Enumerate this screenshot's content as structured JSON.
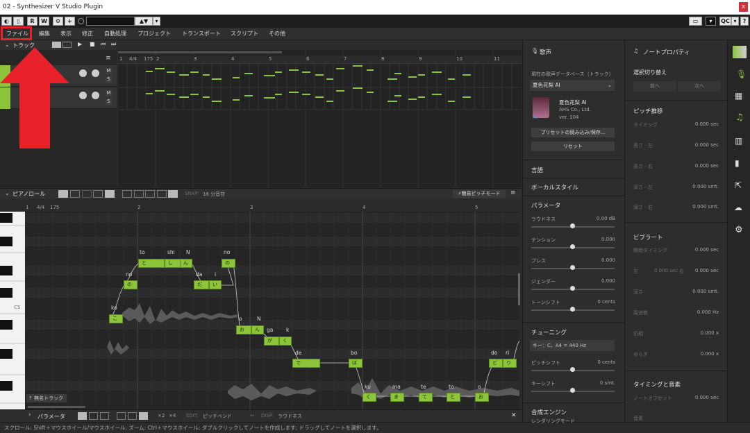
{
  "window": {
    "title": "02 - Synthesizer V Studio Plugin",
    "close": "x"
  },
  "toolbar": {
    "r": "R",
    "w": "W",
    "qc": "QC"
  },
  "menu": [
    "ファイル",
    "編集",
    "表示",
    "修正",
    "自動処理",
    "プロジェクト",
    "トランスポート",
    "スクリプト",
    "その他"
  ],
  "tracks": {
    "header": "トラック",
    "ruler": [
      "1",
      "4/4",
      "175",
      "2",
      "3",
      "4",
      "5",
      "6",
      "7",
      "8",
      "9",
      "10",
      "11"
    ],
    "mute": "M",
    "solo": "S",
    "mute2": "M",
    "solo2": "S"
  },
  "pianoroll": {
    "title": "ピアノロール",
    "snap_label": "SNAP:",
    "snap_value": "16 分音符",
    "mode": "簡易ピッチモード",
    "ruler": [
      "1",
      "4/4",
      "175",
      "2",
      "3",
      "4",
      "5"
    ],
    "c5": "C5",
    "track_name": "無名トラック",
    "notes": [
      {
        "lyric": "to",
        "text": "と"
      },
      {
        "lyric": "shi",
        "text": "し"
      },
      {
        "lyric": "N",
        "text": "ん"
      },
      {
        "lyric": "no",
        "text": "の"
      },
      {
        "lyric": "no",
        "text": "の"
      },
      {
        "lyric": "da",
        "text": "だ"
      },
      {
        "lyric": "i",
        "text": "い"
      },
      {
        "lyric": "ko",
        "text": "こ"
      },
      {
        "lyric": "o",
        "text": "お"
      },
      {
        "lyric": "N",
        "text": "ん"
      },
      {
        "lyric": "ga",
        "text": "が"
      },
      {
        "lyric": "k",
        "text": "く"
      },
      {
        "lyric": "de",
        "text": "で"
      },
      {
        "lyric": "bo",
        "text": "ぼ"
      },
      {
        "lyric": "ku",
        "text": "く"
      },
      {
        "lyric": "ma",
        "text": "ま"
      },
      {
        "lyric": "te",
        "text": "て"
      },
      {
        "lyric": "to",
        "text": "と"
      },
      {
        "lyric": "o",
        "text": "お"
      },
      {
        "lyric": "do",
        "text": "ど"
      },
      {
        "lyric": "ri",
        "text": "り"
      }
    ]
  },
  "parambar": {
    "title": "パラメータ",
    "x2": "×2",
    "x4": "×4",
    "edit_label": "EDIT:",
    "edit_value": "ピッチベンド",
    "disp_label": "DISP:",
    "disp_value": "ラウドネス",
    "close": "✕"
  },
  "status": "スクロール: Shift＋マウスホイール/マウスホイール; ズーム: Ctrl＋マウスホイール; ダブルクリックしてノートを作成します; ドラッグしてノートを選択します。",
  "voice": {
    "title": "歌声",
    "db_label": "現在の歌声データベース（トラック）",
    "db_value": "夏色花梨 AI",
    "singer": "夏色花梨 AI",
    "company": "AHS Co., Ltd.",
    "version": "ver. 104",
    "ai": "AI",
    "preset_btn": "プリセットの読み込み/保存...",
    "reset_btn": "リセット",
    "language": "言語",
    "vocal_style": "ボーカルスタイル",
    "params_title": "パラメータ",
    "params": [
      {
        "label": "ラウドネス",
        "value": "0.00 dB"
      },
      {
        "label": "テンション",
        "value": "0.000"
      },
      {
        "label": "ブレス",
        "value": "0.000"
      },
      {
        "label": "ジェンダー",
        "value": "0.000"
      },
      {
        "label": "トーンシフト",
        "value": "0 cents"
      }
    ],
    "tuning": "チューニング",
    "key_value": "キー：C、A4 = 440 Hz",
    "pitch_shift": "ピッチシフト",
    "pitch_shift_value": "0 cents",
    "key_shift": "キーシフト",
    "key_shift_value": "0 smt.",
    "engine": "合成エンジン",
    "render_mode": "レンダリングモード"
  },
  "props": {
    "title": "ノートプロパティ",
    "selection": "選択切り替え",
    "prev": "前へ",
    "next": "次へ",
    "pitch_title": "ピッチ推移",
    "pitch": [
      {
        "label": "タイミング",
        "value": "0.000 sec"
      },
      {
        "label": "長さ - 左",
        "value": "0.000 sec"
      },
      {
        "label": "長さ - 右",
        "value": "0.000 sec"
      },
      {
        "label": "深さ - 左",
        "value": "0.000 smt."
      },
      {
        "label": "深さ - 右",
        "value": "0.000 smt."
      }
    ],
    "vib_title": "ビブラート",
    "vib_start": "開始タイミング",
    "vib_start_value": "0.000 sec",
    "vib_left": "左",
    "vib_left_value": "0.000 sec",
    "vib_right": "右",
    "vib_right_value": "0.000 sec",
    "vib": [
      {
        "label": "深さ",
        "value": "0.000 smt."
      },
      {
        "label": "周波数",
        "value": "0.000 Hz"
      },
      {
        "label": "位相",
        "value": "0.000 x"
      },
      {
        "label": "ゆらぎ",
        "value": "0.000 x"
      }
    ],
    "timing_title": "タイミングと音素",
    "offset": "ノートオフセット",
    "offset_value": "0.000 sec",
    "phoneme": "音素"
  },
  "colors": {
    "accent": "#8cc43a",
    "highlight": "#e8202a",
    "panel": "#2d2d2d"
  }
}
